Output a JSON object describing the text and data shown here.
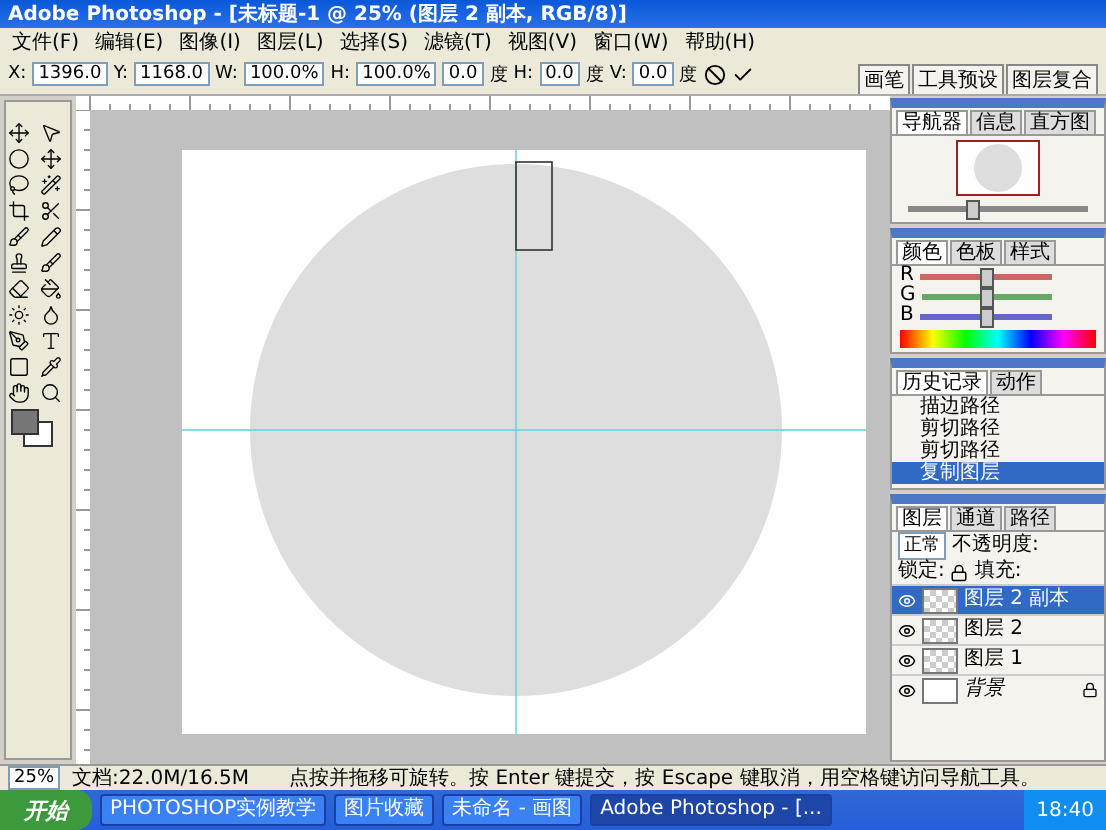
{
  "window": {
    "title": "Adobe Photoshop - [未标题-1 @ 25% (图层 2 副本, RGB/8)]"
  },
  "menu": [
    "文件(F)",
    "编辑(E)",
    "图像(I)",
    "图层(L)",
    "选择(S)",
    "滤镜(T)",
    "视图(V)",
    "窗口(W)",
    "帮助(H)"
  ],
  "options": {
    "fields": [
      {
        "label": "X:",
        "value": "1396.0"
      },
      {
        "label": "Y:",
        "value": "1168.0"
      },
      {
        "label": "W:",
        "value": "100.0%"
      },
      {
        "label": "H:",
        "value": "100.0%"
      },
      {
        "value": "0.0",
        "unit": "度"
      },
      {
        "label": "H:",
        "value": "0.0",
        "unit": "度"
      },
      {
        "label": "V:",
        "value": "0.0",
        "unit": "度"
      }
    ],
    "well_tabs": [
      "画笔",
      "工具预设",
      "图层复合"
    ]
  },
  "navigator": {
    "tabs": [
      {
        "label": "导航器",
        "selected": true
      },
      {
        "label": "信息",
        "selected": false
      },
      {
        "label": "直方图",
        "selected": false
      }
    ],
    "zoom": {
      "level": 0.35
    }
  },
  "color": {
    "tabs": [
      {
        "label": "颜色",
        "selected": true
      },
      {
        "label": "色板",
        "selected": false
      },
      {
        "label": "样式",
        "selected": false
      }
    ],
    "channels": [
      {
        "label": "R",
        "level": 0.5
      },
      {
        "label": "G",
        "level": 0.5
      },
      {
        "label": "B",
        "level": 0.5
      }
    ]
  },
  "history": {
    "tabs": [
      {
        "label": "历史记录",
        "selected": true
      },
      {
        "label": "动作",
        "selected": false
      }
    ],
    "items": [
      {
        "label": "描边路径",
        "selected": false
      },
      {
        "label": "剪切路径",
        "selected": false
      },
      {
        "label": "剪切路径",
        "selected": false
      },
      {
        "label": "复制图层",
        "selected": true
      }
    ]
  },
  "layers": {
    "tabs": [
      {
        "label": "图层",
        "selected": true
      },
      {
        "label": "通道",
        "selected": false
      },
      {
        "label": "路径",
        "selected": false
      }
    ],
    "blend": "正常",
    "opacity_label": "不透明度:",
    "lock_label": "锁定:",
    "fill_label": "填充:",
    "items": [
      {
        "name": "图层 2 副本",
        "kind": "transparent",
        "selected": true,
        "locked": false
      },
      {
        "name": "图层 2",
        "kind": "transparent",
        "selected": false,
        "locked": false
      },
      {
        "name": "图层 1",
        "kind": "transparent",
        "selected": false,
        "locked": false
      },
      {
        "name": "背景",
        "kind": "background",
        "selected": false,
        "locked": true
      }
    ]
  },
  "status": {
    "zoom": "25%",
    "doc": "文档:22.0M/16.5M",
    "hint": "点按并拖移可旋转。按 Enter 键提交，按 Escape 键取消，用空格键访问导航工具。"
  },
  "taskbar": {
    "start": "开始",
    "items": [
      {
        "label": "PHOTOSHOP实例教学",
        "selected": false
      },
      {
        "label": "图片收藏",
        "selected": false
      },
      {
        "label": "未命名 - 画图",
        "selected": false
      },
      {
        "label": "Adobe Photoshop - [...",
        "selected": true
      }
    ],
    "clock": "18:40"
  }
}
